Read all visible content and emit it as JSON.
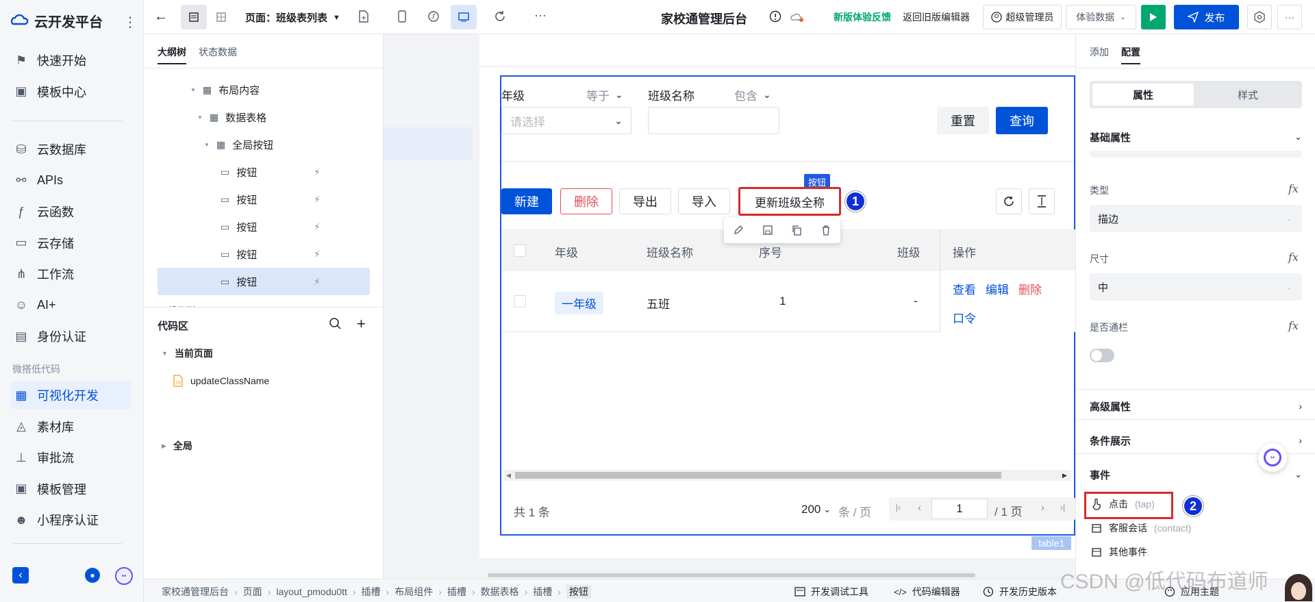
{
  "app": {
    "brand": "云开发平台"
  },
  "nav": {
    "items_top": [
      {
        "label": "快速开始",
        "icon": "flag-icon"
      },
      {
        "label": "模板中心",
        "icon": "template-icon"
      }
    ],
    "items_mid": [
      {
        "label": "云数据库",
        "icon": "database-icon"
      },
      {
        "label": "APIs",
        "icon": "api-icon"
      },
      {
        "label": "云函数",
        "icon": "function-icon"
      },
      {
        "label": "云存储",
        "icon": "folder-icon"
      },
      {
        "label": "工作流",
        "icon": "workflow-icon"
      },
      {
        "label": "AI+",
        "icon": "robot-icon"
      },
      {
        "label": "身份认证",
        "icon": "id-card-icon"
      }
    ],
    "group_label": "微搭低代码",
    "items_low": [
      {
        "label": "可视化开发",
        "icon": "layout-icon",
        "active": true
      },
      {
        "label": "素材库",
        "icon": "shapes-icon"
      },
      {
        "label": "审批流",
        "icon": "stamp-icon"
      },
      {
        "label": "模板管理",
        "icon": "template-manage-icon"
      },
      {
        "label": "小程序认证",
        "icon": "miniprogram-icon"
      }
    ]
  },
  "topbar": {
    "page_label": "页面：班级表列表",
    "title": "家校通管理后台",
    "feedback": "新版体验反馈",
    "back_old": "返回旧版编辑器",
    "user": "超级管理员",
    "data_mode": "体验数据",
    "publish": "发布",
    "accent": "#0052d9",
    "green": "#00a870"
  },
  "outline": {
    "tabs": [
      "大纲树",
      "状态数据"
    ],
    "tree": [
      {
        "label": "布局内容",
        "indent": 0
      },
      {
        "label": "数据表格",
        "indent": 1
      },
      {
        "label": "全局按钮",
        "indent": 2
      },
      {
        "label": "按钮",
        "indent": 3
      },
      {
        "label": "按钮",
        "indent": 3
      },
      {
        "label": "按钮",
        "indent": 3
      },
      {
        "label": "按钮",
        "indent": 3
      },
      {
        "label": "按钮",
        "indent": 3,
        "selected": true
      }
    ],
    "code_title": "代码区",
    "current_page": "当前页面",
    "func": "updateClassName",
    "global": "全局"
  },
  "canvas": {
    "filter": {
      "f1_label": "年级",
      "f1_op": "等于",
      "f1_placeholder": "请选择",
      "f2_label": "班级名称",
      "f2_op": "包含",
      "reset": "重置",
      "query": "查询"
    },
    "toolbar": {
      "new": "新建",
      "delete": "删除",
      "export": "导出",
      "import": "导入",
      "rename": "更新班级全称",
      "tag": "按钮"
    },
    "table": {
      "columns": [
        "年级",
        "班级名称",
        "序号",
        "班级全称",
        "操作"
      ],
      "row": {
        "grade": "一年级",
        "name": "五班",
        "seq": "1",
        "full": "-"
      },
      "actions": [
        "查看",
        "编辑",
        "删除",
        "口令"
      ]
    },
    "pager": {
      "total": "共 1 条",
      "size": "200",
      "size_unit": "条 / 页",
      "page": "1",
      "pages": "/ 1 页"
    },
    "component_tag": "table1",
    "callout1": "1",
    "callout2": "2"
  },
  "right": {
    "tabs": [
      "添加",
      "配置"
    ],
    "seg": [
      "属性",
      "样式"
    ],
    "basic": "基础属性",
    "type_label": "类型",
    "type_value": "描边",
    "size_label": "尺寸",
    "size_value": "中",
    "block_label": "是否通栏",
    "advanced": "高级属性",
    "condition": "条件展示",
    "events": "事件",
    "event_items": [
      {
        "label": "点击",
        "sub": "(tap)"
      },
      {
        "label": "客服会话",
        "sub": "(contact)"
      },
      {
        "label": "其他事件",
        "sub": ""
      }
    ],
    "app_theme": "应用主题",
    "fx": "fx"
  },
  "bottombar": {
    "crumbs": [
      "家校通管理后台",
      "页面",
      "layout_pmodu0tt",
      "插槽",
      "布局组件",
      "插槽",
      "数据表格",
      "插槽",
      "按钮"
    ],
    "dev_tools": "开发调试工具",
    "code_editor": "代码编辑器",
    "history": "开发历史版本"
  },
  "watermark": "CSDN @低代码布道师"
}
